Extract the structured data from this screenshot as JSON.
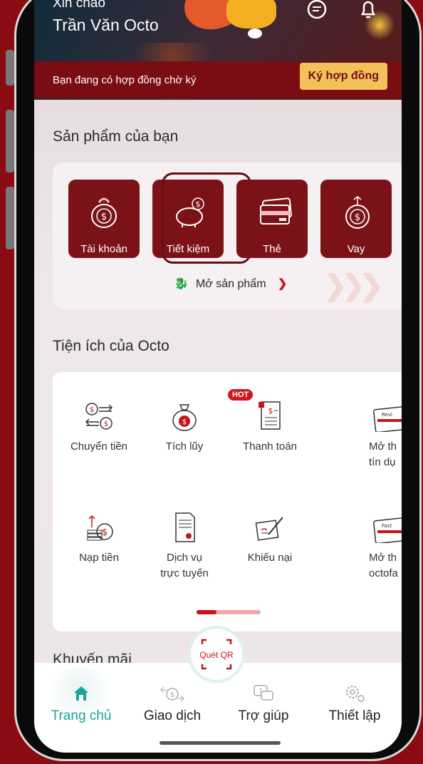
{
  "header": {
    "greeting": "Xin chào",
    "user_name": "Trần Văn Octo",
    "contract_notice": "Bạn đang có hợp đồng chờ ký",
    "contract_button": "Ký hợp đồng"
  },
  "products": {
    "title": "Sản phẩm của bạn",
    "items": [
      {
        "label": "Tài khoản",
        "icon": "moneybag-icon"
      },
      {
        "label": "Tiết kiệm",
        "icon": "piggy-bank-icon"
      },
      {
        "label": "Thẻ",
        "icon": "card-icon"
      },
      {
        "label": "Vay",
        "icon": "coin-icon"
      }
    ],
    "open_label": "Mở sản phẩm"
  },
  "utilities": {
    "title": "Tiện ích của Octo",
    "hot_badge": "HOT",
    "items": [
      {
        "label": "Chuyển tiền",
        "icon": "transfer-icon"
      },
      {
        "label": "Tích lũy",
        "icon": "savings-bag-icon"
      },
      {
        "label": "Thanh toán",
        "icon": "bill-icon"
      },
      {
        "label": "Mở th\ntín dụ",
        "icon": "credit-card-icon"
      },
      {
        "label": "Nạp tiền",
        "icon": "topup-icon"
      },
      {
        "label": "Dịch vụ\ntrực tuyến",
        "icon": "document-icon"
      },
      {
        "label": "Khiếu nại",
        "icon": "complaint-icon"
      },
      {
        "label": "Mở th\noctofa",
        "icon": "fast-card-icon"
      }
    ],
    "card_tag_1": "Revi",
    "card_tag_2": "Fast"
  },
  "promo": {
    "title": "Khuyến mãi"
  },
  "qr": {
    "label": "Quét QR"
  },
  "tabs": [
    {
      "label": "Trang chủ",
      "icon": "home-icon",
      "active": true
    },
    {
      "label": "Giao dịch",
      "icon": "transaction-icon"
    },
    {
      "label": "Trợ giúp",
      "icon": "help-icon"
    },
    {
      "label": "Thiết lập",
      "icon": "settings-icon"
    }
  ],
  "colors": {
    "brand": "#7b1218",
    "accent": "#1aa49a",
    "background": "#8a0c12"
  }
}
